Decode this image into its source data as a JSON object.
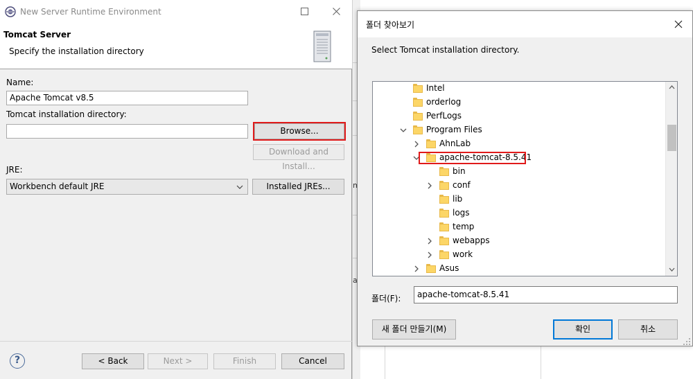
{
  "eclipse_dialog": {
    "title": "New Server Runtime Environment",
    "header_title": "Tomcat Server",
    "header_desc": "Specify the installation directory",
    "name_label": "Name:",
    "name_value": "Apache Tomcat v8.5",
    "dir_label": "Tomcat installation directory:",
    "dir_value": "",
    "browse_label": "Browse...",
    "download_label": "Download and Install...",
    "jre_label": "JRE:",
    "jre_value": "Workbench default JRE",
    "installed_jres_label": "Installed JREs...",
    "back_label": "< Back",
    "next_label": "Next >",
    "finish_label": "Finish",
    "cancel_label": "Cancel",
    "help_glyph": "?"
  },
  "browse_dialog": {
    "title": "폴더 찾아보기",
    "instruction": "Select Tomcat installation directory.",
    "tree": [
      {
        "name": "Intel",
        "expander": "",
        "selected": false
      },
      {
        "name": "orderlog",
        "expander": "",
        "selected": false
      },
      {
        "name": "PerfLogs",
        "expander": "",
        "selected": false
      },
      {
        "name": "Program Files",
        "expander": "expanded",
        "selected": false
      },
      {
        "name": "AhnLab",
        "expander": "collapsed",
        "selected": false
      },
      {
        "name": "apache-tomcat-8.5.41",
        "expander": "expanded",
        "selected": true
      },
      {
        "name": "bin",
        "expander": "",
        "selected": false
      },
      {
        "name": "conf",
        "expander": "collapsed",
        "selected": false
      },
      {
        "name": "lib",
        "expander": "",
        "selected": false
      },
      {
        "name": "logs",
        "expander": "",
        "selected": false
      },
      {
        "name": "temp",
        "expander": "",
        "selected": false
      },
      {
        "name": "webapps",
        "expander": "collapsed",
        "selected": false
      },
      {
        "name": "work",
        "expander": "collapsed",
        "selected": false
      },
      {
        "name": "Asus",
        "expander": "collapsed",
        "selected": false
      }
    ],
    "folder_label": "폴더(F):",
    "folder_value": "apache-tomcat-8.5.41",
    "new_folder_label": "새 폴더 만들기(M)",
    "ok_label": "확인",
    "cancel_label": "취소"
  },
  "background": {
    "fragment_1": "m",
    "fragment_2": "ac"
  },
  "colors": {
    "highlight": "#e01a1a",
    "folder": "#fcd667",
    "default_button_border": "#0078d7"
  }
}
